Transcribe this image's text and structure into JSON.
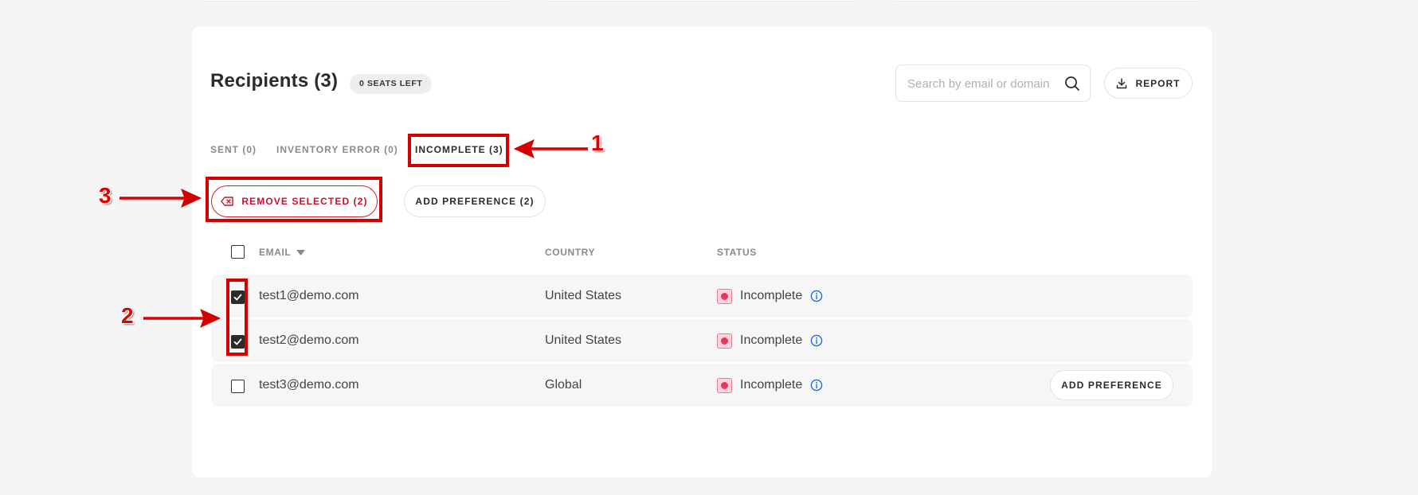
{
  "header": {
    "title": "Recipients (3)",
    "seats_badge": "0 SEATS LEFT",
    "search_placeholder": "Search by email or domain",
    "report_label": "REPORT"
  },
  "tabs": [
    {
      "label": "SENT (0)",
      "active": false
    },
    {
      "label": "INVENTORY ERROR (0)",
      "active": false
    },
    {
      "label": "INCOMPLETE (3)",
      "active": true
    }
  ],
  "actions": {
    "remove_selected_label": "REMOVE SELECTED (2)",
    "add_preference_label": "ADD PREFERENCE (2)"
  },
  "table": {
    "columns": [
      "EMAIL",
      "COUNTRY",
      "STATUS"
    ],
    "rows": [
      {
        "email": "test1@demo.com",
        "country": "United States",
        "status": "Incomplete",
        "checked": true
      },
      {
        "email": "test2@demo.com",
        "country": "United States",
        "status": "Incomplete",
        "checked": true
      },
      {
        "email": "test3@demo.com",
        "country": "Global",
        "status": "Incomplete",
        "checked": false,
        "action_label": "ADD PREFERENCE"
      }
    ]
  },
  "annotations": [
    "1",
    "2",
    "3"
  ],
  "colors": {
    "accent_red": "#c8102e",
    "annotation_red": "#d40000",
    "status_pink": "#e5365d",
    "info_blue": "#1e6fd9"
  },
  "icons": [
    "search-icon",
    "download-icon",
    "backspace-x-icon",
    "sort-down-icon",
    "check-icon",
    "info-icon"
  ]
}
